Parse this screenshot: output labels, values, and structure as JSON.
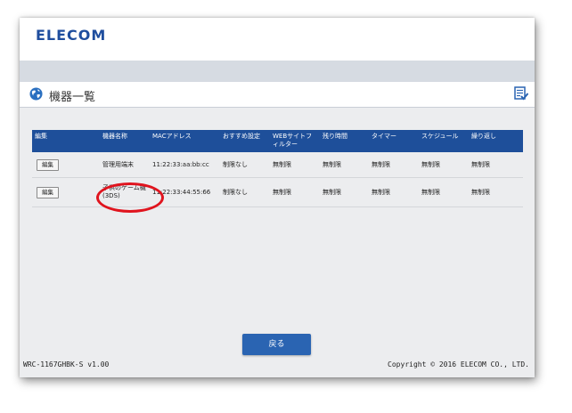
{
  "brand": {
    "logo_text": "ELECOM",
    "logo_color": "#1f4e9e"
  },
  "page": {
    "title": "機器一覧"
  },
  "table": {
    "headers": [
      "編集",
      "機器名称",
      "MACアドレス",
      "おすすめ設定",
      "WEBサイトフィルター",
      "残り時間",
      "タイマー",
      "スケジュール",
      "繰り返し"
    ],
    "rows": [
      {
        "edit_label": "編集",
        "name": "管理用端末",
        "mac": "11:22:33:aa:bb:cc",
        "recommended": "制限なし",
        "web_filter": "無制限",
        "remaining": "無制限",
        "timer": "無制限",
        "schedule": "無制限",
        "repeat": "無制限"
      },
      {
        "edit_label": "編集",
        "name": "子供のゲーム機 (3DS)",
        "mac": "11:22:33:44:55:66",
        "recommended": "制限なし",
        "web_filter": "無制限",
        "remaining": "無制限",
        "timer": "無制限",
        "schedule": "無制限",
        "repeat": "無制限"
      }
    ]
  },
  "buttons": {
    "back_label": "戻る"
  },
  "footer": {
    "model": "WRC-1167GHBK-S v1.00",
    "copyright": "Copyright © 2016 ELECOM CO., LTD."
  },
  "colors": {
    "header_blue": "#1e4f9a",
    "button_blue": "#2a64b2",
    "annotation_red": "#e0141e"
  },
  "icons": {
    "title_icon": "globe-icon",
    "list_icon": "list-check-icon"
  }
}
